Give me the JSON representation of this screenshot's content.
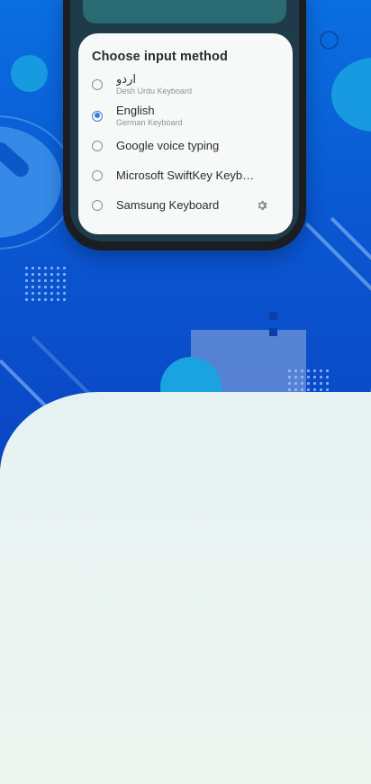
{
  "dialog": {
    "title": "Choose input method",
    "options": [
      {
        "label": "اردو",
        "sub": "Desh Urdu Keyboard",
        "selected": false
      },
      {
        "label": "English",
        "sub": "German Keyboard",
        "selected": true
      },
      {
        "label": "Google voice typing",
        "sub": "",
        "selected": false
      },
      {
        "label": "Microsoft SwiftKey Keyb…",
        "sub": "",
        "selected": false
      },
      {
        "label": "Samsung Keyboard",
        "sub": "",
        "selected": false,
        "settings_icon": "gear-icon"
      }
    ]
  },
  "colors": {
    "hero_blue": "#0a58d2",
    "accent_cyan": "#1aa3e0",
    "radio_selected": "#3b7dd8",
    "page_background": "#e8f2f0"
  }
}
